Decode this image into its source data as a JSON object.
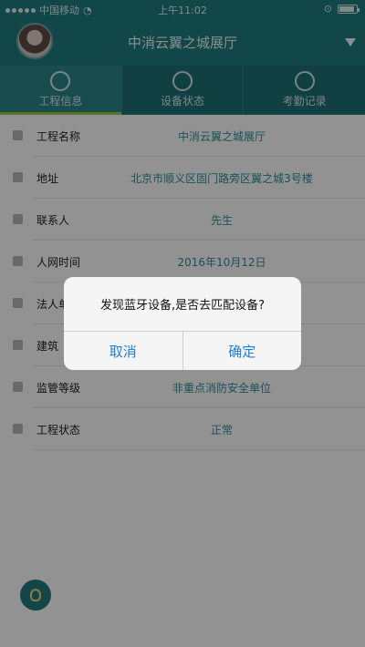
{
  "status_bar": {
    "carrier": "中国移动",
    "time": "上午11:02"
  },
  "header": {
    "title": "中消云翼之城展厅"
  },
  "tabs": [
    {
      "label": "工程信息",
      "icon": "project-info-icon",
      "active": true
    },
    {
      "label": "设备状态",
      "icon": "device-status-icon",
      "active": false
    },
    {
      "label": "考勤记录",
      "icon": "attendance-icon",
      "active": false
    }
  ],
  "info_rows": [
    {
      "icon": "project-name-icon",
      "label": "工程名称",
      "value": "中消云翼之城展厅"
    },
    {
      "icon": "location-pin-icon",
      "label": "地址",
      "value": "北京市顺义区固门路旁区翼之城3号楼"
    },
    {
      "icon": "contact-person-icon",
      "label": "联系人",
      "value": "先生"
    },
    {
      "icon": "clock-icon",
      "label": "人网时间",
      "value": "2016年10月12日"
    },
    {
      "icon": "legal-person-icon",
      "label": "法人单",
      "value": ""
    },
    {
      "icon": "building-icon",
      "label": "建筑",
      "value": ""
    },
    {
      "icon": "supervision-icon",
      "label": "监管等级",
      "value": "非重点消防安全单位"
    },
    {
      "icon": "project-status-icon",
      "label": "工程状态",
      "value": "正常"
    }
  ],
  "dialog": {
    "message": "发现蓝牙设备,是否去匹配设备?",
    "cancel_label": "取消",
    "confirm_label": "确定"
  },
  "colors": {
    "header_bg": "#1e7a7e",
    "tab_active_indicator": "#9ec94a",
    "value_text": "#2b8e93",
    "dialog_button": "#1f7ddc"
  }
}
